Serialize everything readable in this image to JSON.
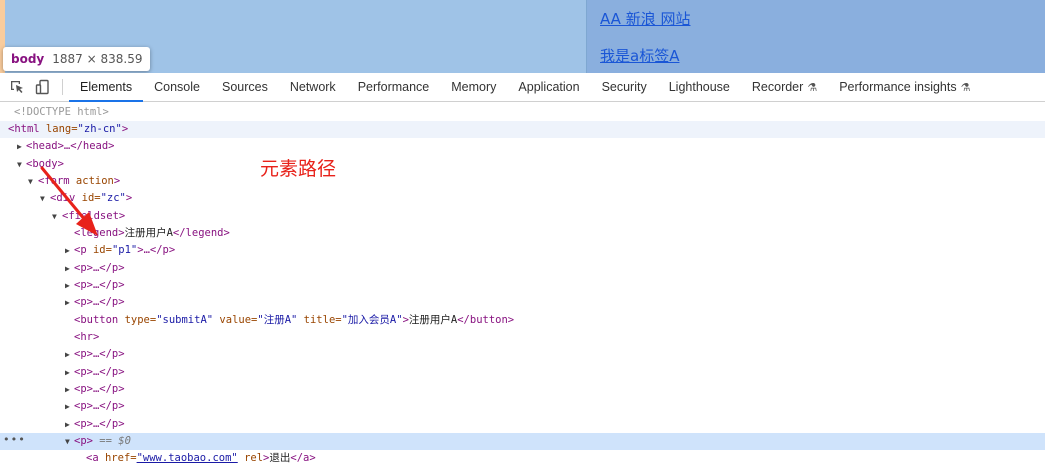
{
  "viewport": {
    "links": [
      "AA 新浪 网站",
      "我是a标签A"
    ]
  },
  "tooltip": {
    "tag": "body",
    "dimensions": "1887 × 838.59"
  },
  "toolbar": {
    "tabs": [
      "Elements",
      "Console",
      "Sources",
      "Network",
      "Performance",
      "Memory",
      "Application",
      "Security",
      "Lighthouse",
      "Recorder",
      "Performance insights"
    ],
    "active_tab": "Elements",
    "icons": [
      "inspect-element-icon",
      "device-toolbar-icon",
      "flask-icon"
    ]
  },
  "dom": {
    "doctype": "<!DOCTYPE html>",
    "html_open": "<html",
    "html_lang_attr": " lang=",
    "html_lang_val": "\"zh-cn\"",
    "head": "<head>…</head>",
    "body": "<body>",
    "form_tag": "<form",
    "form_attr": " action",
    "form_end": ">",
    "div_tag": "<div",
    "div_attr": " id=",
    "div_val": "\"zc\"",
    "fieldset": "<fieldset>",
    "legend_open": "<legend>",
    "legend_text": "注册用户A",
    "legend_close": "</legend>",
    "p_tag": "<p",
    "p_attr": " id=",
    "p_val": "\"p1\"",
    "p_rest": ">…</p>",
    "p_collapsed": "<p>…</p>",
    "button_tag": "<button",
    "button_type_attr": " type=",
    "button_type_val": "\"submitA\"",
    "button_value_attr": " value=",
    "button_value_val": "\"注册A\"",
    "button_title_attr": " title=",
    "button_title_val": "\"加入会员A\"",
    "button_end": ">",
    "button_text": "注册用户A",
    "button_close": "</button>",
    "hr": "<hr>",
    "p_selected": "<p>",
    "selected_marker": " == $0",
    "a_tag": "<a",
    "a_href_attr": " href=",
    "a_href_val": "\"www.taobao.com\"",
    "a_rel_attr": " rel",
    "a_end": ">",
    "a_text": "退出",
    "a_close": "</a>"
  },
  "annotation": {
    "label": "元素路径",
    "color": "#e8221a"
  },
  "colors": {
    "accent": "#1a73e8",
    "tag": "#881280",
    "attr": "#994500",
    "value": "#1a1aa6"
  }
}
